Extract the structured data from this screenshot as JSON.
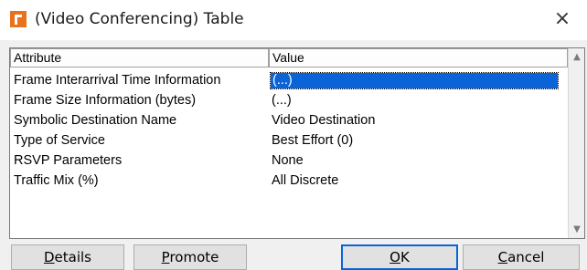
{
  "window": {
    "title": "(Video Conferencing) Table",
    "close_glyph": "×",
    "icon_color": "#e8731c"
  },
  "table": {
    "columns": [
      "Attribute",
      "Value"
    ],
    "rows": [
      {
        "attribute": "Frame Interarrival Time Information",
        "value": "(...)",
        "selected": true
      },
      {
        "attribute": "Frame Size Information (bytes)",
        "value": "(...)"
      },
      {
        "attribute": "Symbolic Destination Name",
        "value": "Video Destination"
      },
      {
        "attribute": "Type of Service",
        "value": "Best Effort (0)"
      },
      {
        "attribute": "RSVP Parameters",
        "value": "None"
      },
      {
        "attribute": "Traffic Mix (%)",
        "value": "All Discrete"
      }
    ],
    "selection_color": "#0a64d8"
  },
  "scrollbar": {
    "up_glyph": "▲",
    "down_glyph": "▼"
  },
  "buttons": {
    "details": "Details",
    "promote": "Promote",
    "ok": "OK",
    "cancel": "Cancel"
  }
}
